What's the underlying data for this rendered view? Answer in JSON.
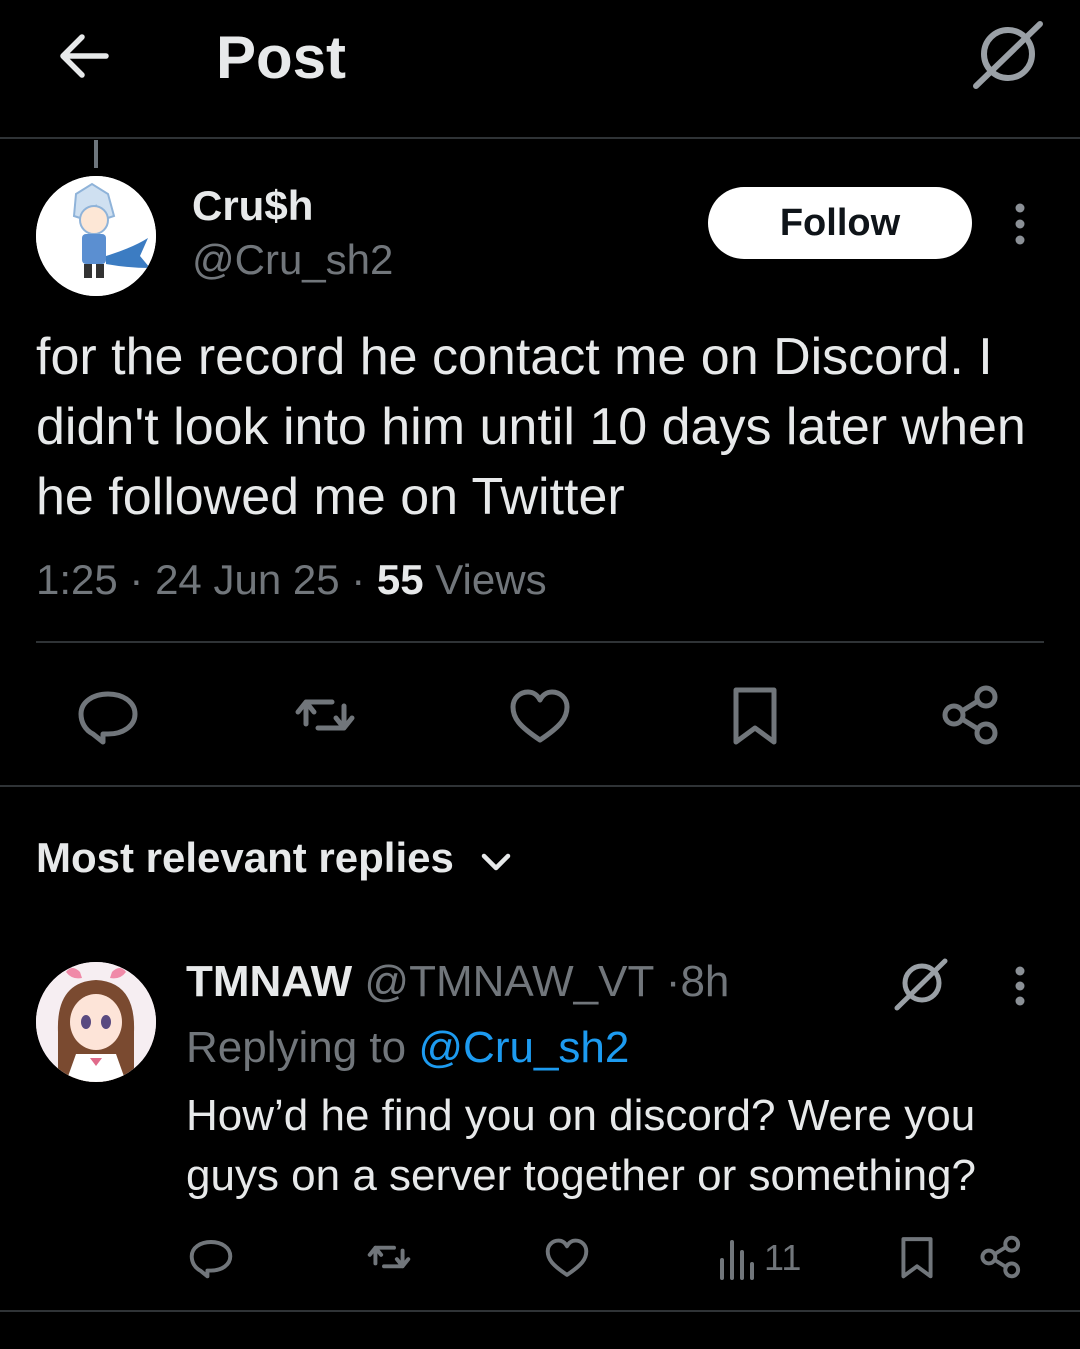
{
  "header": {
    "title": "Post",
    "back_icon": "arrow-left-icon",
    "grok_icon": "grok-icon"
  },
  "post": {
    "author_name": "Cru$h",
    "author_handle": "@Cru_sh2",
    "follow_label": "Follow",
    "text": "for the record he contact me on Discord. I didn't look into him until 10 days later when he followed me on Twitter",
    "time": "1:25",
    "date": "24 Jun 25",
    "views_count": "55",
    "views_label": "Views",
    "actions": [
      "reply-icon",
      "retweet-icon",
      "like-icon",
      "bookmark-icon",
      "share-icon"
    ]
  },
  "replies_section": {
    "sort_label": "Most relevant replies"
  },
  "reply": {
    "author_name": "TMNAW",
    "author_handle": "@TMNAW_VT",
    "age": "8h",
    "replying_prefix": "Replying to",
    "replying_to": "@Cru_sh2",
    "text": "How’d he find you on discord? Were you guys on a server together or something?",
    "views": "11"
  },
  "colors": {
    "background": "#000000",
    "primary_text": "#e7e9ea",
    "secondary_text": "#71767b",
    "accent": "#1d9bf0",
    "divider": "#2f3336"
  }
}
